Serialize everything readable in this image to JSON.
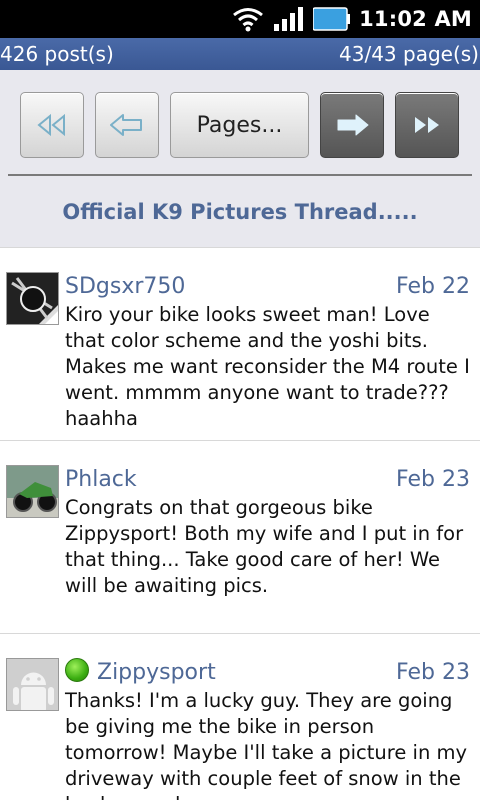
{
  "status_bar": {
    "time": "11:02 AM"
  },
  "info_bar": {
    "posts": "426 post(s)",
    "pages": "43/43 page(s)"
  },
  "toolbar": {
    "pages_label": "Pages..."
  },
  "thread": {
    "title": "Official K9 Pictures Thread....."
  },
  "posts": [
    {
      "author": "SDgsxr750",
      "date": "Feb 22",
      "body": "Kiro your bike looks sweet man! Love that color scheme and the yoshi bits. Makes me want reconsider the M4 route I went. mmmm anyone want to trade??? haahha"
    },
    {
      "author": "Phlack",
      "date": "Feb 23",
      "body": "Congrats on that gorgeous bike Zippysport! Both my wife and I put in for that thing... Take good care of her! We will be awaiting pics."
    },
    {
      "author": "Zippysport",
      "date": "Feb 23",
      "online": true,
      "body": "Thanks! I'm a lucky guy. They are going be giving me the bike in person tomorrow! Maybe I'll take a picture in my driveway with couple feet of snow in the background."
    }
  ],
  "colors": {
    "link": "#4e6896",
    "infobar": "#3a5894"
  }
}
